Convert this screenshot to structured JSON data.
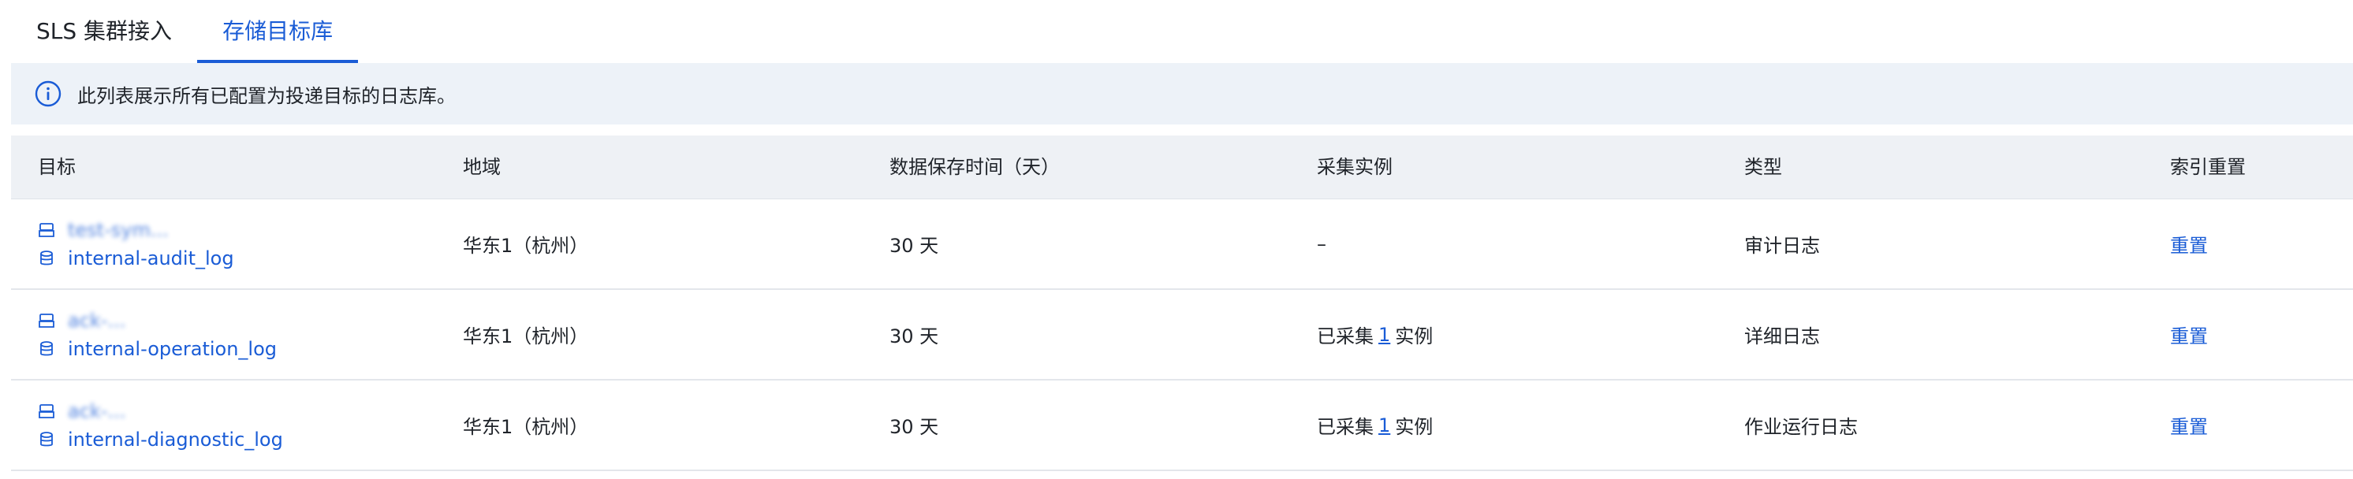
{
  "tabs": [
    {
      "label": "SLS 集群接入",
      "active": false
    },
    {
      "label": "存储目标库",
      "active": true
    }
  ],
  "banner": {
    "icon": "info-icon",
    "text": "此列表展示所有已配置为投递目标的日志库。"
  },
  "table": {
    "columns": [
      "目标",
      "地域",
      "数据保存时间（天）",
      "采集实例",
      "类型",
      "索引重置"
    ],
    "rows": [
      {
        "project": "test-sym...",
        "logstore": "internal-audit_log",
        "region": "华东1（杭州）",
        "retention": "30 天",
        "instances": {
          "text": "–",
          "prefix": "",
          "count": "",
          "suffix": ""
        },
        "type": "审计日志",
        "action": "重置"
      },
      {
        "project": "ack-...",
        "logstore": "internal-operation_log",
        "region": "华东1（杭州）",
        "retention": "30 天",
        "instances": {
          "text": "",
          "prefix": "已采集",
          "count": "1",
          "suffix": "实例"
        },
        "type": "详细日志",
        "action": "重置"
      },
      {
        "project": "ack-...",
        "logstore": "internal-diagnostic_log",
        "region": "华东1（杭州）",
        "retention": "30 天",
        "instances": {
          "text": "",
          "prefix": "已采集",
          "count": "1",
          "suffix": "实例"
        },
        "type": "作业运行日志",
        "action": "重置"
      }
    ]
  },
  "colors": {
    "accent": "#1a5cd6",
    "banner_bg": "#edf2f8",
    "header_bg": "#eef1f5"
  }
}
